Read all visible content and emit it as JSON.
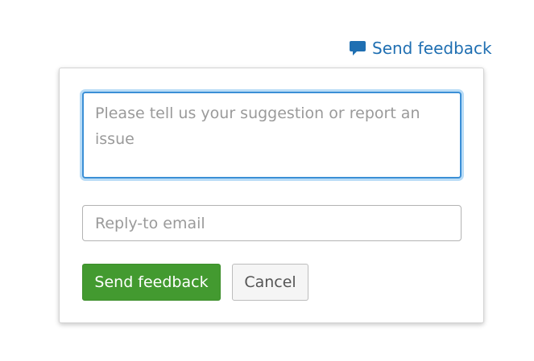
{
  "header": {
    "feedback_link_label": "Send feedback",
    "feedback_icon": "speech-bubble-icon"
  },
  "form": {
    "message_placeholder": "Please tell us your suggestion or report an issue",
    "message_value": "",
    "email_placeholder": "Reply-to email",
    "email_value": "",
    "send_label": "Send feedback",
    "cancel_label": "Cancel"
  },
  "colors": {
    "link": "#1f6fb2",
    "send_button": "#439a30",
    "focus_border": "#3b8fd6",
    "focus_glow": "#b9dcf6",
    "cancel_button": "#f5f5f5"
  }
}
